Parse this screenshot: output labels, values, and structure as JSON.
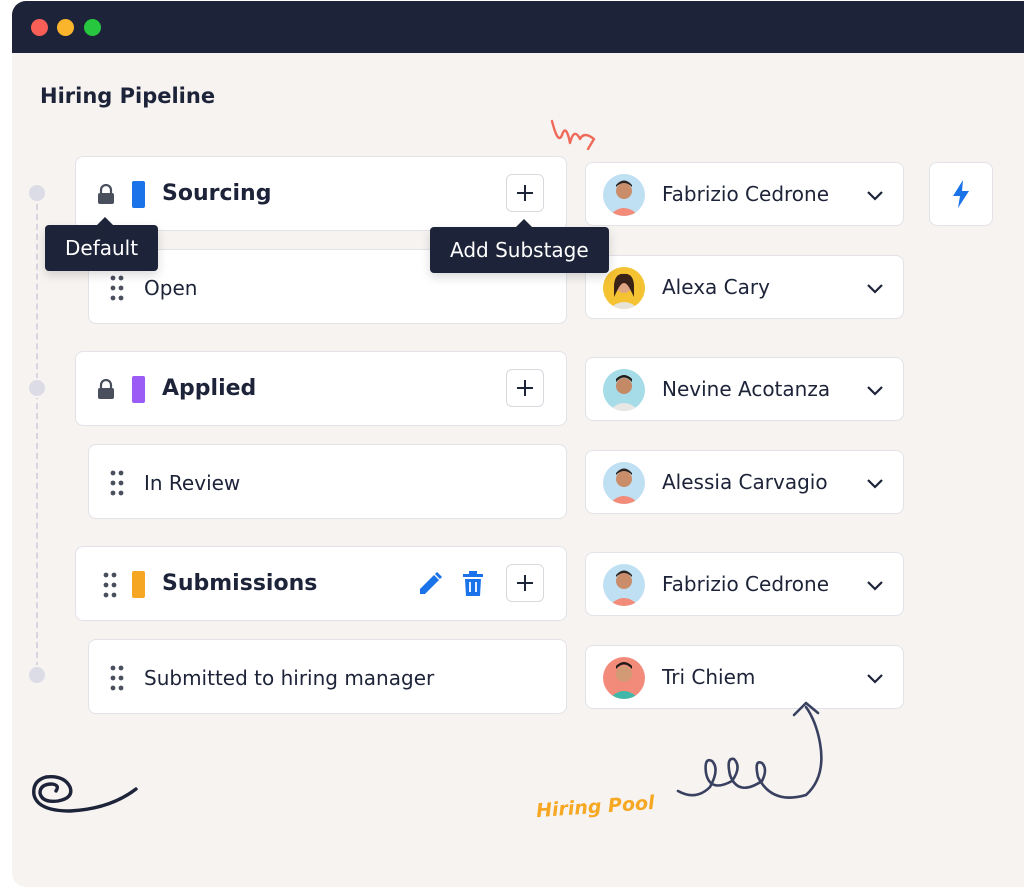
{
  "page_title": "Hiring Pipeline",
  "stages": [
    {
      "label": "Sourcing",
      "color": "#1a73e8",
      "locked": true
    },
    {
      "label": "Applied",
      "color": "#9b5cf6",
      "locked": true
    },
    {
      "label": "Submissions",
      "color": "#f5a623",
      "locked": false
    }
  ],
  "substages": [
    {
      "label": "Open"
    },
    {
      "label": "In Review"
    },
    {
      "label": "Submitted to hiring manager"
    }
  ],
  "assignees": [
    {
      "name": "Fabrizio Cedrone"
    },
    {
      "name": "Alexa Cary"
    },
    {
      "name": "Nevine Acotanza"
    },
    {
      "name": "Alessia Carvagio"
    },
    {
      "name": "Fabrizio Cedrone"
    },
    {
      "name": "Tri Chiem"
    }
  ],
  "tooltips": {
    "default": "Default",
    "add_substage": "Add Substage"
  },
  "annotation": "Hiring Pool",
  "colors": {
    "accent": "#1a73e8",
    "titlebar": "#1d2338",
    "annotation": "#f7a823"
  },
  "icons": [
    "lock-icon",
    "plus-icon",
    "drag-handle-icon",
    "chevron-down-icon",
    "lightning-icon",
    "edit-icon",
    "trash-icon"
  ]
}
